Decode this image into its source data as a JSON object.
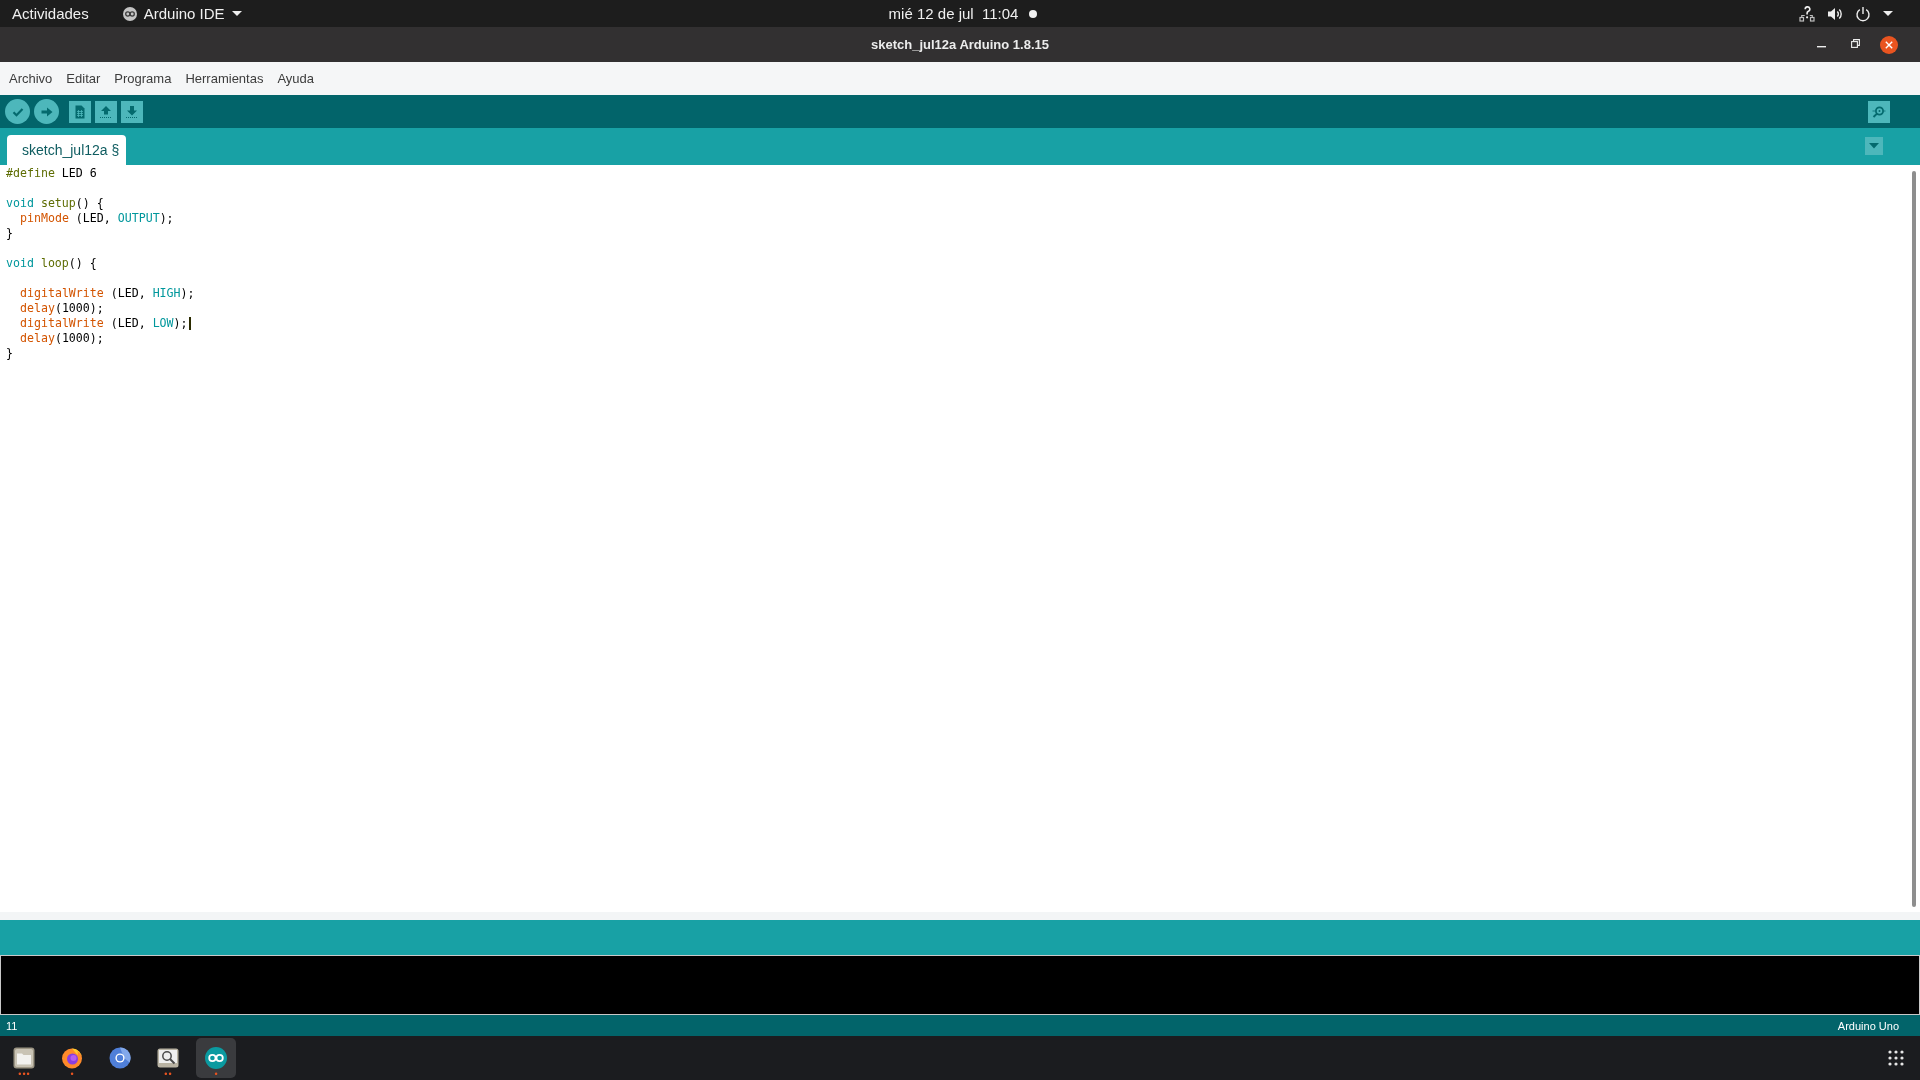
{
  "top_bar": {
    "activities": "Actividades",
    "app_menu": "Arduino IDE",
    "clock": "mié 12 de jul  11:04",
    "notification": true
  },
  "window": {
    "title": "sketch_jul12a Arduino 1.8.15"
  },
  "menu": [
    {
      "label": "Archivo"
    },
    {
      "label": "Editar"
    },
    {
      "label": "Programa"
    },
    {
      "label": "Herramientas"
    },
    {
      "label": "Ayuda"
    }
  ],
  "tabs": [
    {
      "label": "sketch_jul12a §",
      "selected": true
    }
  ],
  "editor": {
    "lines": [
      {
        "kind": "code",
        "tokens": [
          {
            "kind": "preprocessor",
            "text": "#define"
          },
          {
            "kind": "plain",
            "text": " LED 6"
          }
        ]
      },
      {
        "kind": "blank"
      },
      {
        "kind": "code",
        "tokens": [
          {
            "kind": "keyword",
            "text": "void"
          },
          {
            "kind": "function_name",
            "text": " setup"
          },
          {
            "kind": "plain",
            "text": "() {"
          }
        ],
        "children": [
          {
            "kind": "code",
            "tokens": [
              {
                "kind": "function",
                "text": "pinMode"
              },
              {
                "kind": "plain",
                "text": " (LED, "
              },
              {
                "kind": "constant",
                "text": "OUTPUT"
              },
              {
                "kind": "plain",
                "text": ");"
              }
            ]
          }
        ]
      },
      {
        "kind": "code",
        "tokens": [
          {
            "kind": "plain",
            "text": "}"
          }
        ]
      },
      {
        "kind": "blank"
      },
      {
        "kind": "code",
        "tokens": [
          {
            "kind": "keyword",
            "text": "void"
          },
          {
            "kind": "function_name",
            "text": " loop"
          },
          {
            "kind": "plain",
            "text": "() {"
          }
        ],
        "children": [
          {
            "kind": "blank"
          },
          {
            "kind": "code",
            "tokens": [
              {
                "kind": "function",
                "text": "digitalWrite"
              },
              {
                "kind": "plain",
                "text": " (LED, "
              },
              {
                "kind": "constant",
                "text": "HIGH"
              },
              {
                "kind": "plain",
                "text": ");"
              }
            ]
          },
          {
            "kind": "code",
            "tokens": [
              {
                "kind": "function",
                "text": "delay"
              },
              {
                "kind": "plain",
                "text": "(1000);"
              }
            ]
          },
          {
            "kind": "code",
            "tokens": [
              {
                "kind": "function",
                "text": "digitalWrite"
              },
              {
                "kind": "plain",
                "text": " (LED, "
              },
              {
                "kind": "constant",
                "text": "LOW"
              },
              {
                "kind": "plain",
                "text": ");"
              },
              {
                "kind": "cursor"
              }
            ]
          },
          {
            "kind": "code",
            "tokens": [
              {
                "kind": "function",
                "text": "delay"
              },
              {
                "kind": "plain",
                "text": "(1000);"
              }
            ]
          }
        ]
      },
      {
        "kind": "code",
        "tokens": [
          {
            "kind": "plain",
            "text": "}"
          }
        ]
      }
    ]
  },
  "status_bar": {
    "line": "11",
    "board": "Arduino Uno"
  },
  "dock": [
    {
      "indicator": "•••",
      "selected": false
    },
    {
      "indicator": "•",
      "selected": false
    },
    {
      "selected": false
    },
    {
      "indicator": "••",
      "selected": false
    },
    {
      "indicator": "•",
      "selected": true
    }
  ]
}
